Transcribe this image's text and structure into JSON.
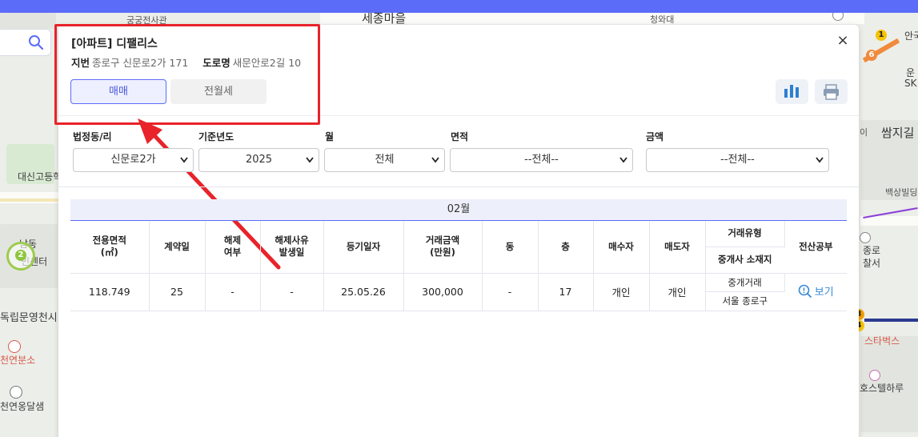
{
  "map": {
    "labels": {
      "sejong": "세종마을",
      "daesin": "대신고등학",
      "dongnip": "독립문영천시",
      "cheonyeon_store": "천연분소",
      "cheonyeon_dalsaem": "천연옹달샘",
      "nam_dong": "남동",
      "center": "민센터",
      "ssamji": "쌈지길",
      "baeksang": "백상빌딩",
      "jongno_1": "종로",
      "jongno_2": "찰서",
      "starbucks": "스타벅스",
      "hotel": "호스텔하루",
      "un": "운",
      "sk": "SK",
      "an": "안국",
      "cheongwa": "청와대",
      "gyeong": "궁궁전사관",
      "small_i": "이"
    },
    "badge": "2",
    "subway_1": "1",
    "subway_6": "6",
    "subway_3": "3",
    "subway_4": "4",
    "colors": {
      "topbar": "#5b6cf9",
      "accent": "#5b6cf9",
      "annotation": "#e8232a"
    }
  },
  "panel": {
    "title": "[아파트] 디팰리스",
    "jibun_label": "지번",
    "jibun_value": "종로구 신문로2가 171",
    "road_label": "도로명",
    "road_value": "새문안로2길 10",
    "tab_sale": "매매",
    "tab_rent": "전월세",
    "close": "×",
    "chart_icon": "bar-chart-icon",
    "print_icon": "printer-icon"
  },
  "filters": {
    "dong_label": "법정동/리",
    "dong_value": "신문로2가",
    "year_label": "기준년도",
    "year_value": "2025",
    "month_label": "월",
    "month_value": "전체",
    "area_label": "면적",
    "area_value": "--전체--",
    "amount_label": "금액",
    "amount_value": "--전체--"
  },
  "table": {
    "month": "02월",
    "headers": {
      "area_1": "전용면적",
      "area_2": "(㎡)",
      "contract_day": "계약일",
      "cancel_1": "해제",
      "cancel_2": "여부",
      "cancel_date_1": "해제사유",
      "cancel_date_2": "발생일",
      "reg_date": "등기일자",
      "price_1": "거래금액",
      "price_2": "(만원)",
      "dong": "동",
      "floor": "층",
      "buyer": "매수자",
      "seller": "매도자",
      "deal_type": "거래유형",
      "agent_loc": "중개사 소재지",
      "ledger": "전산공부"
    },
    "row": {
      "area": "118.749",
      "contract_day": "25",
      "cancel": "-",
      "cancel_date": "-",
      "reg_date": "25.05.26",
      "price": "300,000",
      "dong": "-",
      "floor": "17",
      "buyer": "개인",
      "seller": "개인",
      "deal_type": "중개거래",
      "agent_loc": "서울 종로구",
      "view": "보기"
    }
  }
}
